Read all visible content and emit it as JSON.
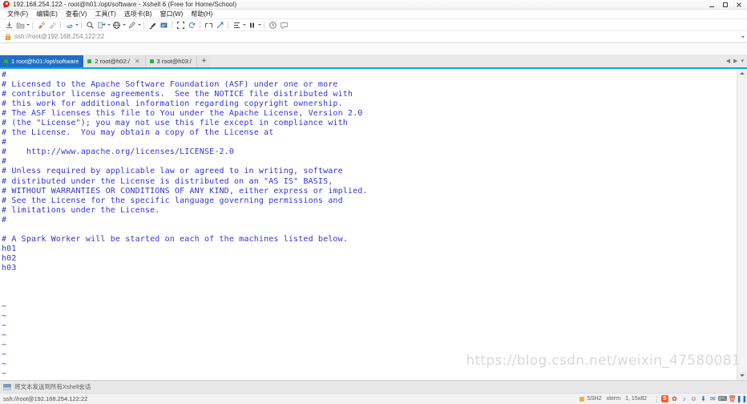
{
  "window": {
    "title": "192.168.254.122 - root@h01:/opt/software - Xshell 6 (Free for Home/School)",
    "app_icon": "xshell-icon",
    "controls": {
      "minimize": "–",
      "maximize": "❐",
      "close": "✕"
    }
  },
  "menubar": {
    "items": [
      {
        "label": "文件(F)",
        "name": "menu-file"
      },
      {
        "label": "编辑(E)",
        "name": "menu-edit"
      },
      {
        "label": "查看(V)",
        "name": "menu-view"
      },
      {
        "label": "工具(T)",
        "name": "menu-tools"
      },
      {
        "label": "选项卡(B)",
        "name": "menu-tab"
      },
      {
        "label": "窗口(W)",
        "name": "menu-window"
      },
      {
        "label": "帮助(H)",
        "name": "menu-help"
      }
    ]
  },
  "toolbar": {
    "buttons": [
      {
        "name": "new-session-button",
        "glyph": "⎘",
        "caret": false
      },
      {
        "name": "open-session-button",
        "glyph": "📁",
        "caret": true
      },
      {
        "name": "separator-1",
        "glyph": "",
        "caret": false
      },
      {
        "name": "connect-button",
        "glyph": "⚡",
        "caret": false
      },
      {
        "name": "disconnect-button",
        "glyph": "⌁",
        "caret": false
      },
      {
        "name": "separator-2",
        "glyph": "",
        "caret": false
      },
      {
        "name": "reconnect-button",
        "glyph": "↻",
        "caret": true
      },
      {
        "name": "separator-3",
        "glyph": "",
        "caret": false
      },
      {
        "name": "find-button",
        "glyph": "🔍",
        "caret": false
      },
      {
        "name": "transfer-file-button",
        "glyph": "⇄",
        "caret": true
      },
      {
        "name": "sftp-browser-button",
        "glyph": "🌐",
        "caret": true
      },
      {
        "name": "log-button",
        "glyph": "✎",
        "caret": true
      },
      {
        "name": "separator-4",
        "glyph": "",
        "caret": false
      },
      {
        "name": "compose-pane-button",
        "glyph": "✒",
        "caret": false
      },
      {
        "name": "send-key-button",
        "glyph": "⌨",
        "caret": false
      },
      {
        "name": "fullscreen-button",
        "glyph": "⛶",
        "caret": false
      },
      {
        "name": "clear-screen-button",
        "glyph": "⟲",
        "caret": false
      },
      {
        "name": "separator-5",
        "glyph": "",
        "caret": false
      },
      {
        "name": "tile-horizontally-button",
        "glyph": "▭",
        "caret": false
      },
      {
        "name": "arrange-button",
        "glyph": "⤢",
        "caret": false
      },
      {
        "name": "separator-6",
        "glyph": "",
        "caret": false
      },
      {
        "name": "properties-button",
        "glyph": "☰",
        "caret": true
      },
      {
        "name": "pause-button",
        "glyph": "❚❚",
        "caret": true
      },
      {
        "name": "separator-7",
        "glyph": "",
        "caret": false
      },
      {
        "name": "highlight-button",
        "glyph": "◎",
        "caret": false
      },
      {
        "name": "comment-button",
        "glyph": "💬",
        "caret": false
      }
    ]
  },
  "addressbar": {
    "icon": "lock-icon",
    "value": "ssh://root@192.168.254.122:22",
    "placeholder": "ssh://"
  },
  "tabs": {
    "items": [
      {
        "label": "1 root@h01:/opt/software",
        "active": true,
        "closable": false
      },
      {
        "label": "2 root@h02:/",
        "active": false,
        "closable": true
      },
      {
        "label": "3 root@h03:/",
        "active": false,
        "closable": false
      }
    ],
    "add_label": "+",
    "nav_prev": "◀",
    "nav_next": "▶",
    "nav_menu": "▾"
  },
  "terminal": {
    "lines": [
      "#",
      "# Licensed to the Apache Software Foundation (ASF) under one or more",
      "# contributor license agreements.  See the NOTICE file distributed with",
      "# this work for additional information regarding copyright ownership.",
      "# The ASF licenses this file to You under the Apache License, Version 2.0",
      "# (the \"License\"); you may not use this file except in compliance with",
      "# the License.  You may obtain a copy of the License at",
      "#",
      "#    http://www.apache.org/licenses/LICENSE-2.0",
      "#",
      "# Unless required by applicable law or agreed to in writing, software",
      "# distributed under the License is distributed on an \"AS IS\" BASIS,",
      "# WITHOUT WARRANTIES OR CONDITIONS OF ANY KIND, either express or implied.",
      "# See the License for the specific language governing permissions and",
      "# limitations under the License.",
      "#",
      "",
      "# A Spark Worker will be started on each of the machines listed below.",
      "h01",
      "h02",
      "h03",
      "",
      "",
      "",
      "~",
      "~",
      "~",
      "~",
      "~",
      "~",
      "~",
      "~",
      "~"
    ],
    "cursor_row_prefix": "~",
    "colors": {
      "background": "#ffffff",
      "foreground": "#3434d6",
      "cursor": "#16e016"
    }
  },
  "watermark": {
    "text": "https://blog.csdn.net/weixin_47580081"
  },
  "hintbar": {
    "icon": "compose-pane-icon",
    "text": "将文本发送到所有Xshell会话"
  },
  "statusbar": {
    "connection": "ssh://root@192.168.254.122:22",
    "protocol": "SSH2",
    "terminal_type": "xterm",
    "dimensions": "1, 15x82",
    "tray": [
      {
        "name": "sogou-input-icon",
        "glyph": "S"
      },
      {
        "name": "flower-icon",
        "glyph": "✿"
      },
      {
        "name": "notes-icon",
        "glyph": "♪"
      },
      {
        "name": "smiley-icon",
        "glyph": "☺"
      },
      {
        "name": "download-icon",
        "glyph": "⬇"
      },
      {
        "name": "mail-icon",
        "glyph": "✉"
      },
      {
        "name": "keyboard-icon",
        "glyph": "⌨"
      },
      {
        "name": "trash-icon",
        "glyph": "🗑"
      },
      {
        "name": "battery-icon",
        "glyph": "❚❚"
      }
    ]
  }
}
